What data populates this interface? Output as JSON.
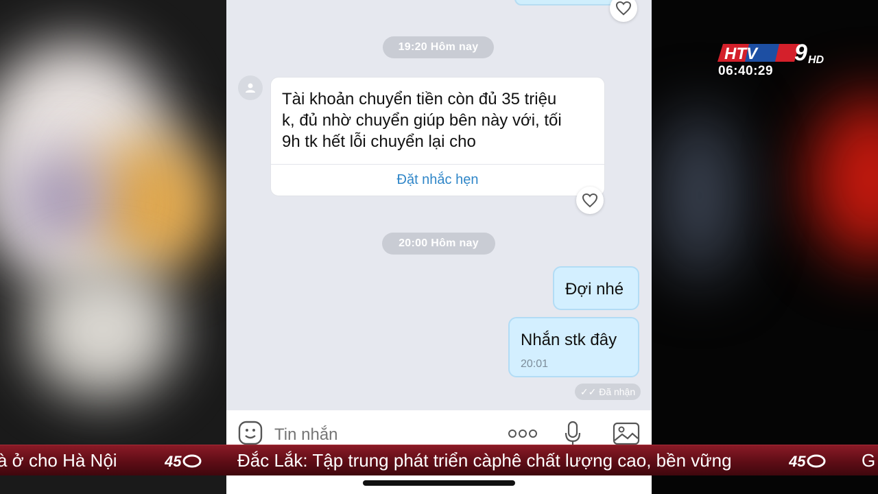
{
  "colors": {
    "chat_background": "#e6e8ef",
    "outgoing_bubble": "#d3efff",
    "link_blue": "#2f86c8",
    "ticker_red": "#6e1019"
  },
  "chat": {
    "separators": [
      {
        "label": "19:20 Hôm nay"
      },
      {
        "label": "20:00 Hôm nay"
      }
    ],
    "incoming_message": {
      "lines": [
        "Tài khoản chuyển tiền còn đủ 35 triệu",
        "k, đủ nhờ chuyển giúp bên này với, tối",
        "9h tk hết lỗi chuyển lại cho"
      ],
      "action_label": "Đặt nhắc hẹn",
      "avatar_icon": "user-icon",
      "reaction_icon": "heart-icon"
    },
    "outgoing_messages": [
      {
        "text": "Đợi nhé"
      },
      {
        "text": "Nhắn stk đây",
        "time": "20:01"
      }
    ],
    "read_status": "Đã nhận",
    "input": {
      "placeholder": "Tin nhắn",
      "emoji_icon": "sticker-icon",
      "more_icon": "more-dots-icon",
      "mic_icon": "microphone-icon",
      "image_icon": "image-icon"
    }
  },
  "broadcast": {
    "channel_logo": "HTV9 HD",
    "clock": "06:40:29",
    "ticker": [
      {
        "text": "à ở cho Hà Nội"
      },
      {
        "text": "Đắc Lắk: Tập trung phát triển càphê chất lượng cao, bền vững"
      },
      {
        "text": "G"
      }
    ]
  }
}
